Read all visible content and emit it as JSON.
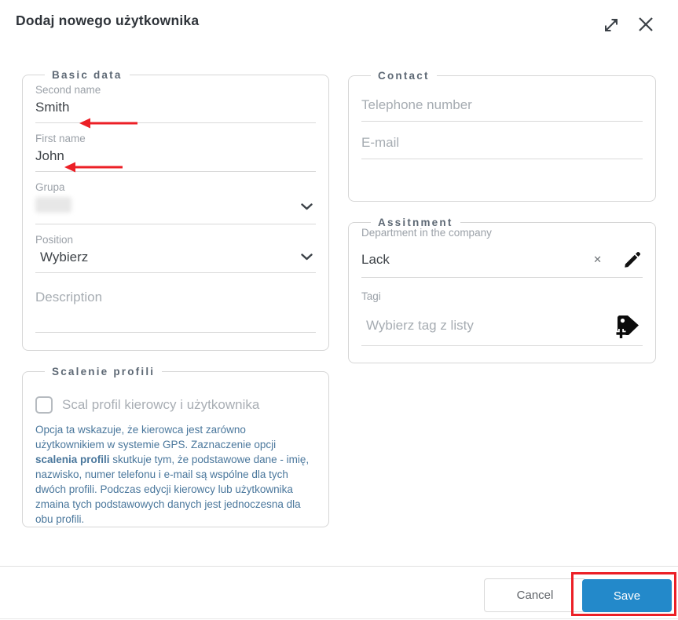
{
  "dialog": {
    "title": "Dodaj nowego użytkownika"
  },
  "basic_data": {
    "legend": "Basic data",
    "second_name": {
      "label": "Second name",
      "value": "Smith"
    },
    "first_name": {
      "label": "First name",
      "value": "John"
    },
    "group": {
      "label": "Grupa",
      "value_redacted": true
    },
    "position": {
      "label": "Position",
      "value": "Wybierz"
    },
    "description": {
      "placeholder": "Description"
    }
  },
  "contact": {
    "legend": "Contact",
    "telephone": {
      "placeholder": "Telephone number"
    },
    "email": {
      "placeholder": "E-mail"
    }
  },
  "assignment": {
    "legend": "Assitnment",
    "department": {
      "label": "Department in the company",
      "value": "Lack"
    },
    "tags": {
      "label": "Tagi",
      "placeholder": "Wybierz tag z listy"
    }
  },
  "merge_profiles": {
    "legend": "Scalenie profili",
    "checkbox_label": "Scal profil kierowcy i użytkownika",
    "checked": false,
    "description_part1": "Opcja ta wskazuje, że kierowca jest zarówno użytkownikiem w systemie GPS. Zaznaczenie opcji ",
    "description_bold": "scalenia profili",
    "description_part2": " skutkuje tym, że podstawowe dane - imię, nazwisko, numer telefonu i e-mail są wspólne dla tych dwóch profili. Podczas edycji kierowcy lub użytkownika zmaina tych podstawowych danych jest jednoczesna dla obu profili."
  },
  "footer": {
    "cancel_label": "Cancel",
    "save_label": "Save"
  },
  "icons": {
    "clear": "✕"
  },
  "colors": {
    "accent_blue": "#2389ca",
    "annotation_red": "#ec1f26",
    "description_blue": "#4a779c",
    "text_dark": "#3e4348",
    "text_muted": "#9ba1a8"
  }
}
